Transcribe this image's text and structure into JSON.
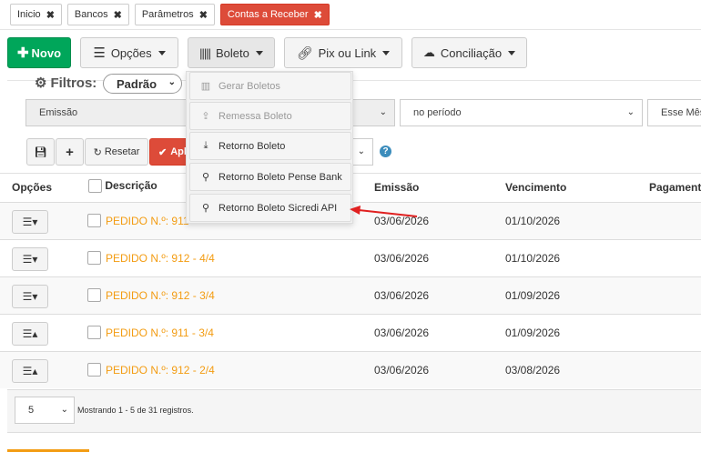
{
  "tabs": [
    {
      "label": "Inicio"
    },
    {
      "label": "Bancos"
    },
    {
      "label": "Parâmetros"
    },
    {
      "label": "Contas a Receber"
    }
  ],
  "toolbar": {
    "novo": "Novo",
    "opcoes": "Opções",
    "boleto": "Boleto",
    "pix": "Pix ou Link",
    "conciliacao": "Conciliação"
  },
  "filters": {
    "title": "Filtros:",
    "preset": "Padrão",
    "field": "Emissão",
    "period": "no período",
    "month": "Esse Mês",
    "reset": "Resetar",
    "apply": "Apl"
  },
  "boleto_menu": [
    {
      "label": "Gerar Boletos",
      "disabled": true,
      "icon": "barcode-icon"
    },
    {
      "label": "Remessa Boleto",
      "disabled": true,
      "icon": "upload-icon"
    },
    {
      "label": "Retorno Boleto",
      "disabled": false,
      "icon": "download-icon"
    },
    {
      "label": "Retorno Boleto Pense Bank",
      "disabled": false,
      "icon": "search-icon"
    },
    {
      "label": "Retorno Boleto Sicredi API",
      "disabled": false,
      "icon": "search-icon"
    }
  ],
  "table": {
    "headers": {
      "opcoes": "Opções",
      "descricao": "Descrição",
      "emissao": "Emissão",
      "vencimento": "Vencimento",
      "pagamento": "Pagament"
    },
    "rows": [
      {
        "descricao": "PEDIDO N.º: 911",
        "emissao": "03/06/2026",
        "vencimento": "01/10/2026"
      },
      {
        "descricao": "PEDIDO N.º: 912 - 4/4",
        "emissao": "03/06/2026",
        "vencimento": "01/10/2026"
      },
      {
        "descricao": "PEDIDO N.º: 912 - 3/4",
        "emissao": "03/06/2026",
        "vencimento": "01/09/2026"
      },
      {
        "descricao": "PEDIDO N.º: 911 - 3/4",
        "emissao": "03/06/2026",
        "vencimento": "01/09/2026"
      },
      {
        "descricao": "PEDIDO N.º: 912 - 2/4",
        "emissao": "03/06/2026",
        "vencimento": "03/08/2026"
      }
    ]
  },
  "pagination": {
    "page_size": "5",
    "info": "Mostrando 1 - 5 de 31 registros."
  },
  "colors": {
    "novo": "#00a65a",
    "active_tab": "#dd4b39",
    "link": "#f39c12",
    "arrow": "#e02020"
  }
}
